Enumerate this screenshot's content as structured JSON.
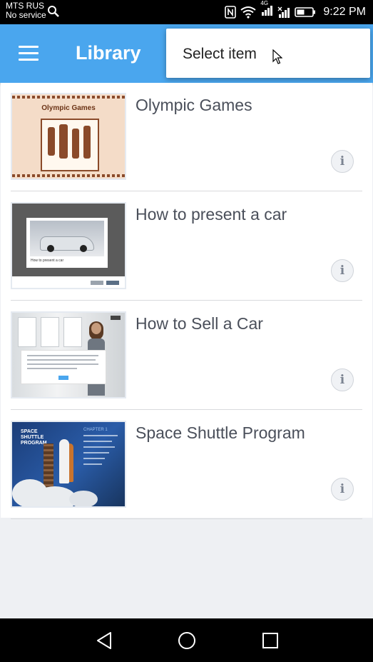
{
  "status_bar": {
    "carrier_line1": "MTS RUS",
    "carrier_line2": "No service",
    "network_type": "4G",
    "time": "9:22 PM"
  },
  "app_bar": {
    "title": "Library",
    "menu_icon": "hamburger-menu-icon",
    "background_color": "#4aa6ee"
  },
  "popup_menu": {
    "items": [
      {
        "label": "Select item"
      }
    ]
  },
  "library": {
    "items": [
      {
        "title": "Olympic Games",
        "thumbnail_text": "Olympic Games",
        "info_label": "i"
      },
      {
        "title": "How to present a car",
        "thumbnail_text": "How to present a car",
        "info_label": "i"
      },
      {
        "title": "How to Sell a Car",
        "info_label": "i"
      },
      {
        "title": "Space Shuttle Program",
        "thumbnail_text": "SPACE SHUTTLE PROGRAM",
        "thumbnail_chapter": "CHAPTER 1",
        "info_label": "i"
      }
    ]
  },
  "nav_bar": {
    "back_icon": "back-triangle-icon",
    "home_icon": "home-circle-icon",
    "recents_icon": "recents-square-icon"
  }
}
